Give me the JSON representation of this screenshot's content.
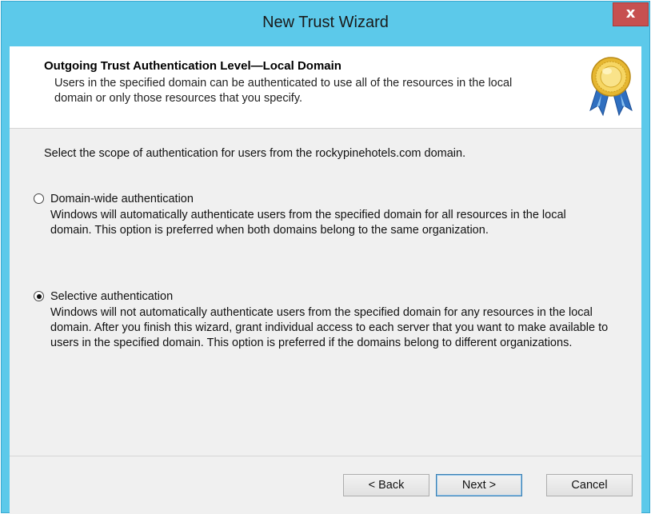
{
  "window": {
    "title": "New Trust Wizard",
    "close_label": "x"
  },
  "header": {
    "title": "Outgoing Trust Authentication Level—Local Domain",
    "subtitle": "Users in the specified domain can be authenticated to use all of the resources in the local domain or only those resources that you specify.",
    "icon": "award-ribbon-icon"
  },
  "main": {
    "prompt": "Select the scope of authentication for users from the rockypinehotels.com domain.",
    "options": [
      {
        "label": "Domain-wide authentication",
        "description": "Windows will automatically authenticate users from the specified domain for all resources in the local domain. This option is preferred when both domains belong to the same organization.",
        "selected": false
      },
      {
        "label": "Selective authentication",
        "description": "Windows will not automatically authenticate users from the specified domain for any resources in the local domain. After you finish this wizard, grant individual access to each server that you want to make available to users in the specified domain. This option is preferred if the domains belong to different organizations.",
        "selected": true
      }
    ]
  },
  "buttons": {
    "back": "< Back",
    "next": "Next >",
    "cancel": "Cancel"
  },
  "colors": {
    "titlebar": "#5cc9ea",
    "close": "#c75050",
    "client": "#f0f0f0"
  }
}
